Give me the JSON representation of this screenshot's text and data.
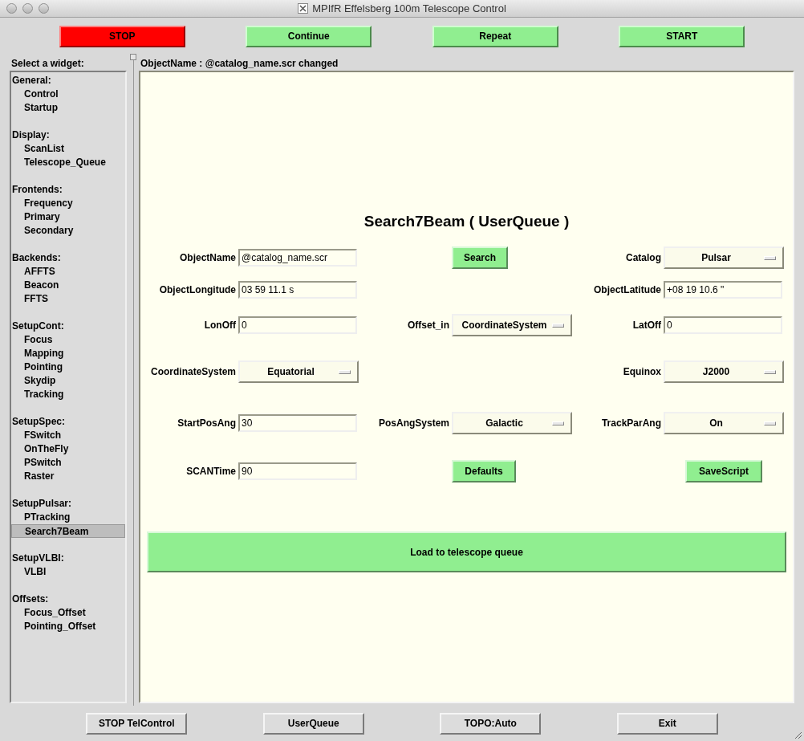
{
  "window": {
    "title": "MPIfR Effelsberg 100m Telescope Control"
  },
  "top_buttons": [
    {
      "label": "STOP",
      "kind": "stop"
    },
    {
      "label": "Continue",
      "kind": "go"
    },
    {
      "label": "Repeat",
      "kind": "go"
    },
    {
      "label": "START",
      "kind": "go"
    }
  ],
  "sidebar": {
    "heading": "Select a widget:",
    "groups": [
      {
        "label": "General:",
        "items": [
          {
            "label": "Control",
            "selected": false
          },
          {
            "label": "Startup",
            "selected": false
          }
        ]
      },
      {
        "label": "Display:",
        "items": [
          {
            "label": "ScanList",
            "selected": false
          },
          {
            "label": "Telescope_Queue",
            "selected": false
          }
        ]
      },
      {
        "label": "Frontends:",
        "items": [
          {
            "label": "Frequency",
            "selected": false
          },
          {
            "label": "Primary",
            "selected": false
          },
          {
            "label": "Secondary",
            "selected": false
          }
        ]
      },
      {
        "label": "Backends:",
        "items": [
          {
            "label": "AFFTS",
            "selected": false
          },
          {
            "label": "Beacon",
            "selected": false
          },
          {
            "label": "FFTS",
            "selected": false
          }
        ]
      },
      {
        "label": "SetupCont:",
        "items": [
          {
            "label": "Focus",
            "selected": false
          },
          {
            "label": "Mapping",
            "selected": false
          },
          {
            "label": "Pointing",
            "selected": false
          },
          {
            "label": "Skydip",
            "selected": false
          },
          {
            "label": "Tracking",
            "selected": false
          }
        ]
      },
      {
        "label": "SetupSpec:",
        "items": [
          {
            "label": "FSwitch",
            "selected": false
          },
          {
            "label": "OnTheFly",
            "selected": false
          },
          {
            "label": "PSwitch",
            "selected": false
          },
          {
            "label": "Raster",
            "selected": false
          }
        ]
      },
      {
        "label": "SetupPulsar:",
        "items": [
          {
            "label": "PTracking",
            "selected": false
          },
          {
            "label": "Search7Beam",
            "selected": true
          }
        ]
      },
      {
        "label": "SetupVLBI:",
        "items": [
          {
            "label": "VLBI",
            "selected": false
          }
        ]
      },
      {
        "label": "Offsets:",
        "items": [
          {
            "label": "Focus_Offset",
            "selected": false
          },
          {
            "label": "Pointing_Offset",
            "selected": false
          }
        ]
      }
    ]
  },
  "status_message": "ObjectName :  @catalog_name.scr changed",
  "form": {
    "title": "Search7Beam ( UserQueue )",
    "rows": [
      [
        {
          "kind": "field",
          "label": "ObjectName",
          "value": "@catalog_name.scr"
        },
        {
          "kind": "button",
          "label": "Search"
        },
        {
          "kind": "dropdown",
          "label": "Catalog",
          "value": "Pulsar"
        }
      ],
      [
        {
          "kind": "field",
          "label": "ObjectLongitude",
          "value": "03 59 11.1 s"
        },
        {
          "kind": "empty"
        },
        {
          "kind": "field",
          "label": "ObjectLatitude",
          "value": "+08 19 10.6 \""
        }
      ],
      [
        {
          "kind": "field",
          "label": "LonOff",
          "value": "0"
        },
        {
          "kind": "dropdown",
          "label": "Offset_in",
          "value": "CoordinateSystem"
        },
        {
          "kind": "field",
          "label": "LatOff",
          "value": "0"
        }
      ],
      [
        {
          "kind": "dropdown",
          "label": "CoordinateSystem",
          "value": "Equatorial"
        },
        {
          "kind": "empty"
        },
        {
          "kind": "dropdown",
          "label": "Equinox",
          "value": "J2000"
        }
      ],
      [
        {
          "kind": "field",
          "label": "StartPosAng",
          "value": "30"
        },
        {
          "kind": "dropdown",
          "label": "PosAngSystem",
          "value": "Galactic"
        },
        {
          "kind": "dropdown",
          "label": "TrackParAng",
          "value": "On"
        }
      ],
      [
        {
          "kind": "field",
          "label": "SCANTime",
          "value": "90"
        },
        {
          "kind": "button",
          "label": "Defaults"
        },
        {
          "kind": "button",
          "label": "SaveScript"
        }
      ]
    ],
    "load_button": "Load to telescope queue"
  },
  "bottom_buttons": [
    "STOP TelControl",
    "UserQueue",
    "TOPO:Auto",
    "Exit"
  ]
}
